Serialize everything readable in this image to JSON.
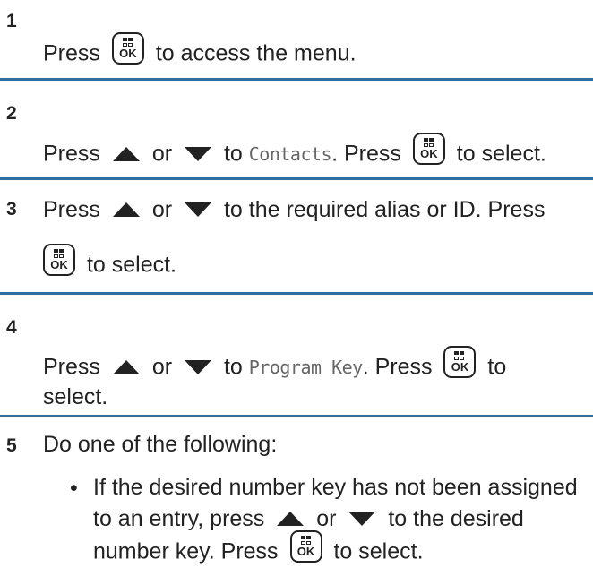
{
  "steps": [
    {
      "number": "1",
      "text_a": "Press",
      "text_b": "to access the menu."
    },
    {
      "number": "2",
      "text_a": "Press",
      "or": "or",
      "to": "to",
      "lcd": "Contacts",
      "press": ". Press",
      "select": "to select."
    },
    {
      "number": "3",
      "text_a": "Press",
      "or": "or",
      "rest": "to the required alias or ID. Press",
      "select": "to select."
    },
    {
      "number": "4",
      "text_a": "Press",
      "or": "or",
      "to": "to",
      "lcd": "Program Key",
      "press": ". Press",
      "to2": "to",
      "select": "select."
    },
    {
      "number": "5",
      "text": "Do one of the following:"
    }
  ],
  "bullet": {
    "symbol": "•",
    "line1": "If the desired number key has not been assigned",
    "line2_a": "to an entry, press",
    "or": "or",
    "line2_b": "to the desired",
    "line3_a": "number key. Press",
    "line3_b": "to select."
  },
  "icons": {
    "menu_ok_key": "menu-ok-key-icon",
    "up": "up-arrow-icon",
    "down": "down-arrow-icon"
  },
  "key_label": "OK",
  "colors": {
    "separator": "#2f6f9e",
    "text": "#222222",
    "lcd": "#666666"
  }
}
